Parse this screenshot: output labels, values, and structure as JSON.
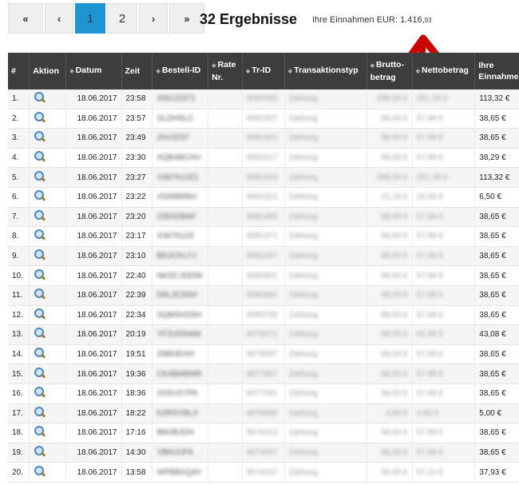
{
  "pagination": {
    "first": "«",
    "prev": "‹",
    "pages": [
      "1",
      "2"
    ],
    "active_page": "1",
    "next": "›",
    "last": "»"
  },
  "result_count": "32 Ergebnisse",
  "income": {
    "label": "Ihre Einnahmen EUR:",
    "amount_main": "1.416,",
    "amount_cents": "93"
  },
  "table": {
    "columns": [
      "#",
      "Aktion",
      "Datum",
      "Zeit",
      "Bestell-ID",
      "Rate Nr.",
      "Tr-ID",
      "Transaktionstyp",
      "Brutto-betrag",
      "Nettobetrag",
      "Ihre Einnahmen"
    ],
    "rows": [
      {
        "n": "1.",
        "date": "18.06.2017",
        "time": "23:58",
        "oid": "XNUJ2371",
        "trid": "9082083",
        "typ": "Zahlung",
        "brutto": "298,00 €",
        "netto": "251,28 €",
        "earn": "113,32 €"
      },
      {
        "n": "2.",
        "date": "18.06.2017",
        "time": "23:57",
        "oid": "SLDHSLC",
        "trid": "9081607",
        "typ": "Zahlung",
        "brutto": "98,00 €",
        "netto": "57,99 €",
        "earn": "38,65 €"
      },
      {
        "n": "3.",
        "date": "18.06.2017",
        "time": "23:49",
        "oid": "ZHJJZ37",
        "trid": "9081601",
        "typ": "Zahlung",
        "brutto": "98,00 €",
        "netto": "57,99 €",
        "earn": "38,65 €"
      },
      {
        "n": "4.",
        "date": "18.06.2017",
        "time": "23:30",
        "oid": "XQB4BCHU",
        "trid": "9081617",
        "typ": "Zahlung",
        "brutto": "98,00 €",
        "netto": "57,99 €",
        "earn": "38,29 €"
      },
      {
        "n": "5.",
        "date": "18.06.2017",
        "time": "23:27",
        "oid": "X367NJJZ1",
        "trid": "9081603",
        "typ": "Zahlung",
        "brutto": "298,00 €",
        "netto": "251,28 €",
        "earn": "113,32 €"
      },
      {
        "n": "6.",
        "date": "18.06.2017",
        "time": "23:22",
        "oid": "VGM8MMJ",
        "trid": "9081521",
        "typ": "Zahlung",
        "brutto": "21,18 €",
        "netto": "15,00 €",
        "earn": "6,50 €"
      },
      {
        "n": "7.",
        "date": "18.06.2017",
        "time": "23:20",
        "oid": "23D3ZBAF",
        "trid": "9081485",
        "typ": "Zahlung",
        "brutto": "68,00 €",
        "netto": "57,99 €",
        "earn": "38,65 €"
      },
      {
        "n": "8.",
        "date": "18.06.2017",
        "time": "23:17",
        "oid": "X367NJJZ",
        "trid": "9081471",
        "typ": "Zahlung",
        "brutto": "68,00 €",
        "netto": "57,99 €",
        "earn": "38,65 €"
      },
      {
        "n": "9.",
        "date": "18.06.2017",
        "time": "23:10",
        "oid": "BK2CKLYJ",
        "trid": "9081337",
        "typ": "Zahlung",
        "brutto": "68,00 €",
        "netto": "57,99 €",
        "earn": "38,65 €"
      },
      {
        "n": "10.",
        "date": "18.06.2017",
        "time": "22:40",
        "oid": "NKDCJDDW",
        "trid": "9080801",
        "typ": "Zahlung",
        "brutto": "68,00 €",
        "netto": "57,99 €",
        "earn": "38,65 €"
      },
      {
        "n": "11.",
        "date": "18.06.2017",
        "time": "22:39",
        "oid": "D6L3C5SH",
        "trid": "9080881",
        "typ": "Zahlung",
        "brutto": "68,00 €",
        "netto": "57,99 €",
        "earn": "38,65 €"
      },
      {
        "n": "12.",
        "date": "18.06.2017",
        "time": "22:34",
        "oid": "SQM3VDSH",
        "trid": "9080755",
        "typ": "Zahlung",
        "brutto": "68,00 €",
        "netto": "57,99 €",
        "earn": "38,65 €"
      },
      {
        "n": "13.",
        "date": "18.06.2017",
        "time": "20:19",
        "oid": "YF2UDNAM",
        "trid": "9078471",
        "typ": "Zahlung",
        "brutto": "68,00 €",
        "netto": "63,99 €",
        "earn": "43,08 €"
      },
      {
        "n": "14.",
        "date": "18.06.2017",
        "time": "19:51",
        "oid": "Z8BHEHH",
        "trid": "9078037",
        "typ": "Zahlung",
        "brutto": "68,00 €",
        "netto": "57,99 €",
        "earn": "38,65 €"
      },
      {
        "n": "15.",
        "date": "18.06.2017",
        "time": "19:36",
        "oid": "CKABABW8",
        "trid": "9077807",
        "typ": "Zahlung",
        "brutto": "68,00 €",
        "netto": "57,99 €",
        "earn": "38,65 €"
      },
      {
        "n": "16.",
        "date": "18.06.2017",
        "time": "18:36",
        "oid": "2SSUS7PA",
        "trid": "9077001",
        "typ": "Zahlung",
        "brutto": "68,00 €",
        "netto": "57,99 €",
        "earn": "38,65 €"
      },
      {
        "n": "17.",
        "date": "18.06.2017",
        "time": "18:22",
        "oid": "K2RSYBLX",
        "trid": "9076880",
        "typ": "Zahlung",
        "brutto": "4,80 €",
        "netto": "4,80 €",
        "earn": "5,00 €"
      },
      {
        "n": "18.",
        "date": "18.06.2017",
        "time": "17:16",
        "oid": "BMJBJDN",
        "trid": "9076313",
        "typ": "Zahlung",
        "brutto": "68,00 €",
        "netto": "57,99 €",
        "earn": "38,65 €"
      },
      {
        "n": "19.",
        "date": "18.06.2017",
        "time": "14:30",
        "oid": "VB6UUFA",
        "trid": "9074057",
        "typ": "Zahlung",
        "brutto": "68,00 €",
        "netto": "57,99 €",
        "earn": "38,65 €"
      },
      {
        "n": "20.",
        "date": "18.06.2017",
        "time": "13:58",
        "oid": "WPBBXQAY",
        "trid": "9074207",
        "typ": "Zahlung",
        "brutto": "68,00 €",
        "netto": "57,22 €",
        "earn": "37,93 €"
      }
    ]
  },
  "colors": {
    "active_page_bg": "#1e94d2",
    "header_bg": "#3d3d3d",
    "arrow": "#cc0000"
  },
  "icons": {
    "view_action": "magnifier-icon",
    "arrow_annotation": "red-arrow-icon"
  }
}
